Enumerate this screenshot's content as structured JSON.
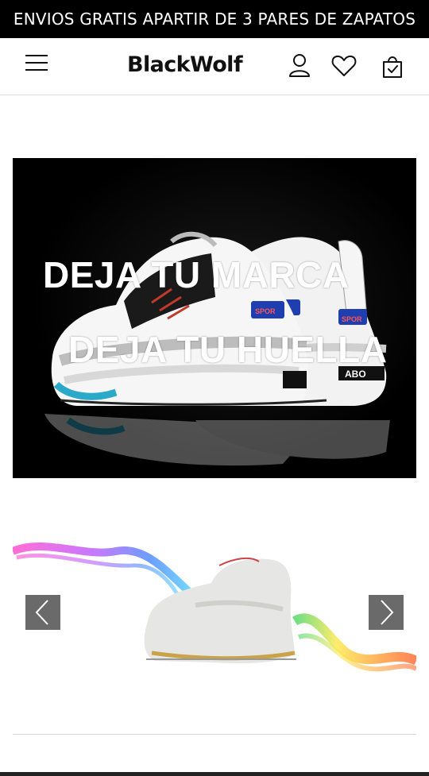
{
  "announcement": {
    "text": "ENVIOS GRATIS APARTIR DE 3 PARES DE ZAPATOS"
  },
  "header": {
    "logo": "BlackWolf",
    "icons": [
      "menu-icon",
      "user-icon",
      "heart-icon",
      "shopping-bag-icon"
    ]
  },
  "hero": {
    "line1": "DEJA TU MARCA",
    "line2": "DEJA TU HUELLA",
    "shoe_tags": [
      "SPOR",
      "SPOR",
      "ABO"
    ]
  },
  "slider": {
    "prev_icon": "chevron-left-icon",
    "next_icon": "chevron-right-icon"
  },
  "colors": {
    "announcement_bg": "#000000",
    "text": "#111111",
    "arrow_bg": "#505050"
  }
}
